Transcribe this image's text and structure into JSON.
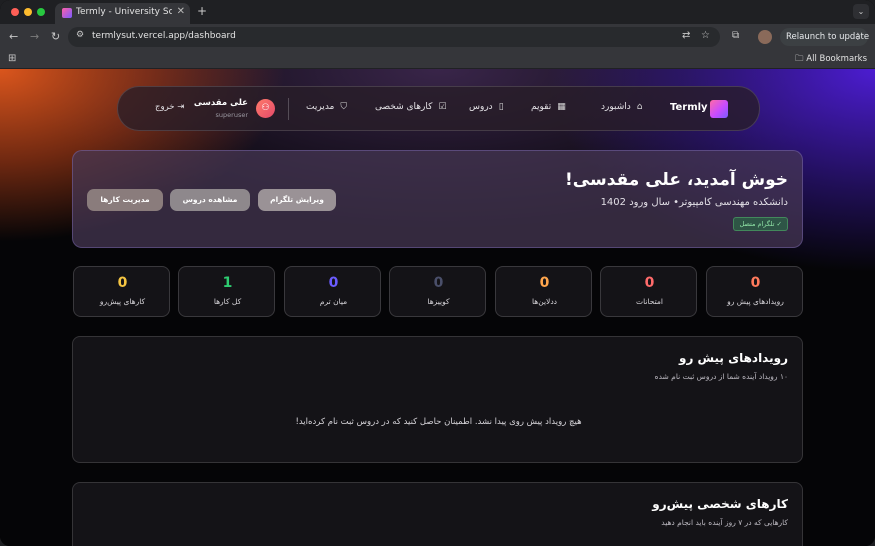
{
  "browser": {
    "tab_title": "Termly - University Schedule",
    "url": "termlysut.vercel.app/dashboard",
    "relaunch_label": "Relaunch to update",
    "bookmarks_label": "All Bookmarks"
  },
  "nav": {
    "brand": "Termly",
    "items": [
      {
        "label": "داشبورد",
        "icon": "home-icon",
        "glyph": "⌂"
      },
      {
        "label": "تقویم",
        "icon": "calendar-icon",
        "glyph": "▦"
      },
      {
        "label": "دروس",
        "icon": "book-icon",
        "glyph": "▯"
      },
      {
        "label": "کارهای شخصی",
        "icon": "check-square-icon",
        "glyph": "☑"
      },
      {
        "label": "مدیریت",
        "icon": "shield-icon",
        "glyph": "⛉"
      }
    ],
    "user_name": "علی مقدسی",
    "user_role": "superuser",
    "logout_label": "خروج"
  },
  "welcome": {
    "title": "خوش آمدید، علی مقدسی!",
    "subtitle": "دانشکده مهندسی کامپیوتر• سال ورود 1402",
    "badge": "✓ تلگرام متصل",
    "buttons": {
      "edit_telegram": "ویرایش تلگرام",
      "view_courses": "مشاهده دروس",
      "manage_tasks": "مدیریت کارها"
    }
  },
  "stats": [
    {
      "value": "0",
      "label": "رویدادهای پیش رو",
      "color": "#ff7a5c"
    },
    {
      "value": "0",
      "label": "امتحانات",
      "color": "#ff6b6b"
    },
    {
      "value": "0",
      "label": "ددلاین‌ها",
      "color": "#ffa64d"
    },
    {
      "value": "0",
      "label": "کوییزها",
      "color": "#4a4f6a"
    },
    {
      "value": "0",
      "label": "میان ترم",
      "color": "#6b5cff"
    },
    {
      "value": "1",
      "label": "کل کارها",
      "color": "#2ecc71"
    },
    {
      "value": "0",
      "label": "کارهای پیش‌رو",
      "color": "#f5c542"
    }
  ],
  "events_panel": {
    "title": "رویدادهای پیش رو",
    "subtitle": "۱۰ رویداد آینده شما از دروس ثبت نام شده",
    "empty": "هیچ رویداد پیش روی پیدا نشد. اطمینان حاصل کنید که در دروس ثبت نام کرده‌اید!"
  },
  "tasks_panel": {
    "title": "کارهای شخصی پیش‌رو",
    "subtitle": "کارهایی که در ۷ روز آینده باید انجام دهید"
  }
}
